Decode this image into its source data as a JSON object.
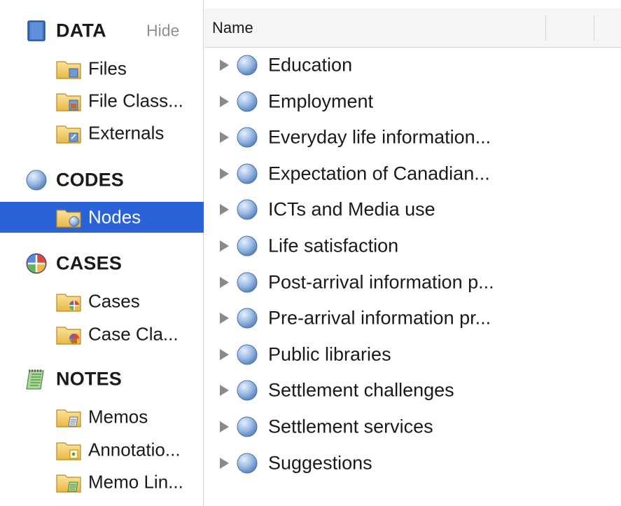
{
  "sidebar": {
    "data_section": {
      "label": "DATA",
      "hide_label": "Hide",
      "icon": "data-book-icon"
    },
    "data_items": [
      {
        "label": "Files",
        "icon": "files-folder-icon"
      },
      {
        "label": "File Class...",
        "icon": "file-classifications-folder-icon"
      },
      {
        "label": "Externals",
        "icon": "externals-folder-icon"
      }
    ],
    "codes_section": {
      "label": "CODES",
      "icon": "codes-ball-icon"
    },
    "codes_items": [
      {
        "label": "Nodes",
        "icon": "nodes-folder-icon",
        "selected": true
      }
    ],
    "cases_section": {
      "label": "CASES",
      "icon": "cases-icon"
    },
    "cases_items": [
      {
        "label": "Cases",
        "icon": "cases-folder-icon"
      },
      {
        "label": "Case Cla...",
        "icon": "case-classifications-folder-icon"
      }
    ],
    "notes_section": {
      "label": "NOTES",
      "icon": "notes-icon"
    },
    "notes_items": [
      {
        "label": "Memos",
        "icon": "memos-folder-icon"
      },
      {
        "label": "Annotatio...",
        "icon": "annotations-folder-icon"
      },
      {
        "label": "Memo Lin...",
        "icon": "memo-links-folder-icon"
      }
    ]
  },
  "main": {
    "column_header": {
      "name": "Name"
    },
    "nodes": [
      "Education",
      "Employment",
      "Everyday life information...",
      "Expectation of Canadian...",
      "ICTs and Media use",
      "Life satisfaction",
      "Post-arrival information p...",
      "Pre-arrival information pr...",
      "Public libraries",
      "Settlement challenges",
      "Settlement services",
      "Suggestions"
    ]
  },
  "colors": {
    "selection": "#2a63d8",
    "node_ball": "#8fb3e2",
    "folder": "#f1c95a"
  }
}
